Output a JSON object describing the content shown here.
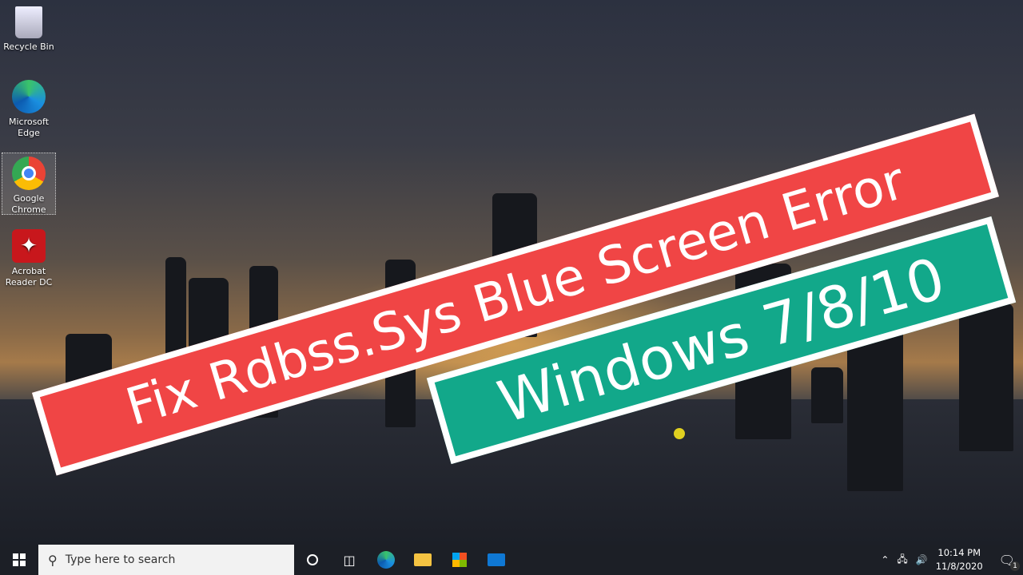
{
  "desktop_icons": [
    {
      "label": "Recycle Bin",
      "icon": "recycle-bin-icon"
    },
    {
      "label": "Microsoft Edge",
      "icon": "edge-icon"
    },
    {
      "label": "Google Chrome",
      "icon": "chrome-icon",
      "selected": true
    },
    {
      "label": "Acrobat Reader DC",
      "icon": "acrobat-icon"
    }
  ],
  "overlay": {
    "title": "Fix Rdbss.Sys Blue Screen Error",
    "subtitle": "Windows 7/8/10",
    "title_color": "#f04545",
    "subtitle_color": "#12a88a"
  },
  "taskbar": {
    "search_placeholder": "Type here to search",
    "time": "10:14 PM",
    "date": "11/8/2020",
    "notification_count": "1",
    "pinned": [
      "task-view",
      "edge",
      "file-explorer",
      "microsoft-store",
      "mail"
    ]
  }
}
